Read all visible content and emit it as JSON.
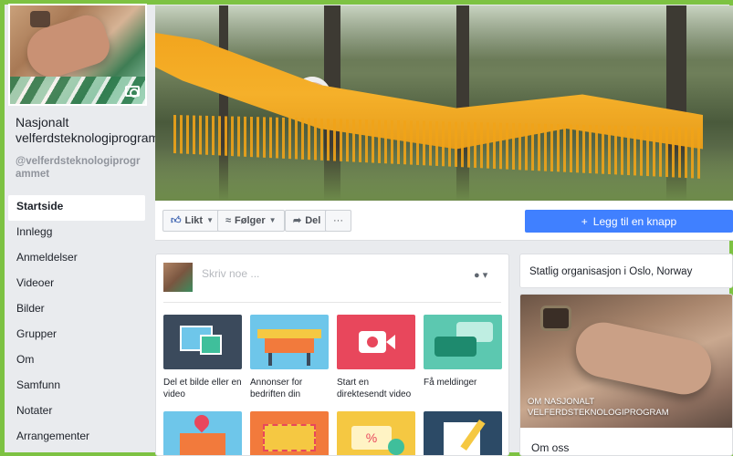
{
  "page": {
    "name": "Nasjonalt velferdsteknologiprogram",
    "handle": "@velferdsteknologiprogrammet"
  },
  "sidebar": {
    "items": [
      {
        "label": "Startside",
        "active": true
      },
      {
        "label": "Innlegg"
      },
      {
        "label": "Anmeldelser"
      },
      {
        "label": "Videoer"
      },
      {
        "label": "Bilder"
      },
      {
        "label": "Grupper"
      },
      {
        "label": "Om"
      },
      {
        "label": "Samfunn"
      },
      {
        "label": "Notater"
      },
      {
        "label": "Arrangementer"
      }
    ]
  },
  "actions": {
    "like": "Likt",
    "follow": "Følger",
    "share": "Del",
    "more": "···",
    "add_button": "Legg til en knapp"
  },
  "composer": {
    "placeholder": "Skriv noe ...",
    "tiles": [
      {
        "label": "Del et bilde eller en video",
        "icon": "photo-video-icon",
        "color": "#3b4a5c"
      },
      {
        "label": "Annonser for bedriften din",
        "icon": "shop-stall-icon",
        "color": "#6ec6ea"
      },
      {
        "label": "Start en direktesendt video",
        "icon": "live-camera-icon",
        "color": "#e8475c"
      },
      {
        "label": "Få meldinger",
        "icon": "chat-bubbles-icon",
        "color": "#5cc8b0"
      },
      {
        "label": "",
        "icon": "location-store-icon",
        "color": "#6ec6ea"
      },
      {
        "label": "",
        "icon": "ticket-icon",
        "color": "#f27a3c"
      },
      {
        "label": "",
        "icon": "discount-icon",
        "color": "#f5c842"
      },
      {
        "label": "",
        "icon": "note-icon",
        "color": "#2c4a66"
      }
    ]
  },
  "info": {
    "category": "Statlig organisasjon i Oslo, Norway"
  },
  "about": {
    "caption": "OM NASJONALT VELFERDSTEKNOLOGIPROGRAM",
    "title": "Om oss"
  },
  "colors": {
    "frame": "#7dc242",
    "primary": "#4080ff",
    "background": "#e9ebee"
  }
}
